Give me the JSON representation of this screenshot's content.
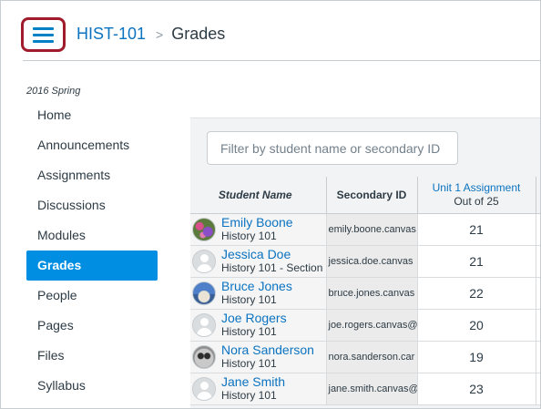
{
  "header": {
    "course_link": "HIST-101",
    "separator": ">",
    "current_page": "Grades"
  },
  "sidebar": {
    "term": "2016 Spring",
    "items": [
      {
        "label": "Home"
      },
      {
        "label": "Announcements"
      },
      {
        "label": "Assignments"
      },
      {
        "label": "Discussions"
      },
      {
        "label": "Modules"
      },
      {
        "label": "Grades",
        "active": true
      },
      {
        "label": "People"
      },
      {
        "label": "Pages"
      },
      {
        "label": "Files"
      },
      {
        "label": "Syllabus"
      }
    ]
  },
  "gradebook": {
    "filter_placeholder": "Filter by student name or secondary ID",
    "columns": {
      "student": "Student Name",
      "secondary": "Secondary ID",
      "assignment_title": "Unit 1 Assignment",
      "assignment_points": "Out of 25"
    },
    "rows": [
      {
        "name": "Emily Boone",
        "section": "History 101",
        "secondary_id": "emily.boone.canvas",
        "grade": "21",
        "avatar": "flower-photo-avatar"
      },
      {
        "name": "Jessica Doe",
        "section": "History 101 - Section",
        "secondary_id": "jessica.doe.canvas",
        "grade": "21",
        "avatar": "default-user-avatar"
      },
      {
        "name": "Bruce Jones",
        "section": "History 101",
        "secondary_id": "bruce.jones.canvas",
        "grade": "22",
        "avatar": "sky-photo-avatar"
      },
      {
        "name": "Joe Rogers",
        "section": "History 101",
        "secondary_id": "joe.rogers.canvas@",
        "grade": "20",
        "avatar": "default-user-avatar"
      },
      {
        "name": "Nora Sanderson",
        "section": "History 101",
        "secondary_id": "nora.sanderson.car",
        "grade": "19",
        "avatar": "raccoon-photo-avatar"
      },
      {
        "name": "Jane Smith",
        "section": "History 101",
        "secondary_id": "jane.smith.canvas@",
        "grade": "23",
        "avatar": "default-user-avatar"
      }
    ]
  },
  "colors": {
    "accent": "#008ee2",
    "link": "#0b73c0",
    "hamburger_highlight": "#a01c2c"
  }
}
